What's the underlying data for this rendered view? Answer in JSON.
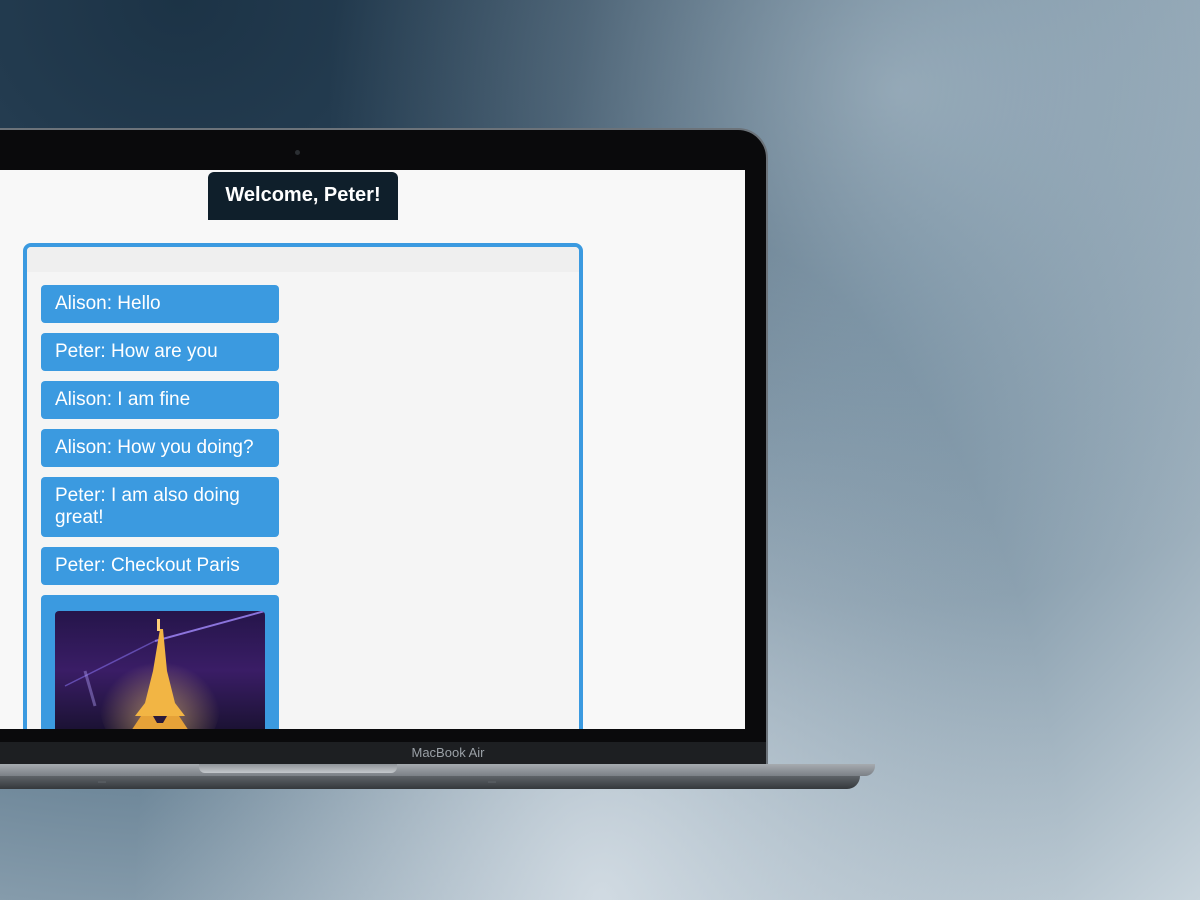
{
  "device": {
    "label": "MacBook Air"
  },
  "app": {
    "welcome_text": "Welcome, Peter!",
    "accent_color": "#3b9ae0",
    "header_color": "#0f1f2b"
  },
  "chat": {
    "messages": [
      {
        "text": "Alison: Hello"
      },
      {
        "text": "Peter: How are you"
      },
      {
        "text": "Alison: I am fine"
      },
      {
        "text": "Alison: How you doing?"
      },
      {
        "text": "Peter: I am also doing great!"
      },
      {
        "text": "Peter: Checkout Paris"
      }
    ],
    "image_message": {
      "subject": "eiffel-tower-night"
    }
  }
}
